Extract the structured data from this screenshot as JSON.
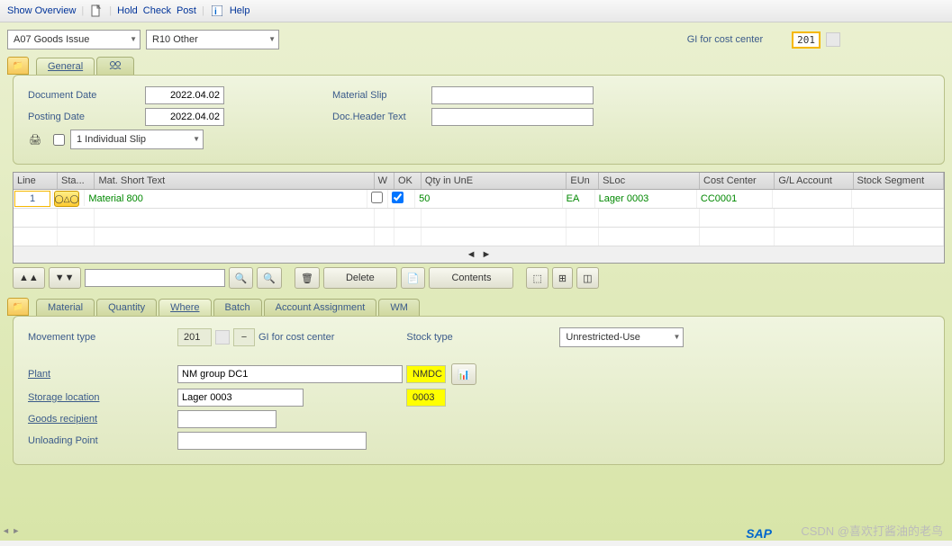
{
  "toolbar": {
    "show_overview": "Show Overview",
    "hold": "Hold",
    "check": "Check",
    "post": "Post",
    "help": "Help"
  },
  "selectors": {
    "action": "A07 Goods Issue",
    "ref": "R10 Other",
    "gi_label": "GI for cost center",
    "mvt_code": "201"
  },
  "tabs_top": {
    "general": "General"
  },
  "header": {
    "doc_date_label": "Document Date",
    "doc_date": "2022.04.02",
    "post_date_label": "Posting Date",
    "post_date": "2022.04.02",
    "slip": "1 Individual Slip",
    "mat_slip_label": "Material Slip",
    "mat_slip": "",
    "doc_header_label": "Doc.Header Text",
    "doc_header": ""
  },
  "grid": {
    "cols": {
      "line": "Line",
      "sta": "Sta...",
      "mst": "Mat. Short Text",
      "w": "W",
      "ok": "OK",
      "qty": "Qty in UnE",
      "eun": "EUn",
      "sloc": "SLoc",
      "cc": "Cost Center",
      "gl": "G/L Account",
      "ss": "Stock Segment"
    },
    "row": {
      "line": "1",
      "mst": "Material 800",
      "qty": "50",
      "eun": "EA",
      "sloc": "Lager 0003",
      "cc": "CC0001"
    }
  },
  "buttons": {
    "delete": "Delete",
    "contents": "Contents"
  },
  "tabs_bottom": {
    "material": "Material",
    "quantity": "Quantity",
    "where": "Where",
    "batch": "Batch",
    "account": "Account Assignment",
    "wm": "WM"
  },
  "detail": {
    "mvt_label": "Movement type",
    "mvt": "201",
    "mvt_text": "GI for cost center",
    "stock_label": "Stock type",
    "stock": "Unrestricted-Use",
    "plant_label": "Plant",
    "plant": "NM group DC1",
    "plant_code": "NMDC",
    "sloc_label": "Storage location",
    "sloc": "Lager 0003",
    "sloc_code": "0003",
    "recip_label": "Goods recipient",
    "recip": "",
    "unload_label": "Unloading Point",
    "unload": ""
  },
  "watermark": "CSDN @喜欢打酱油的老鸟",
  "sap": "SAP"
}
